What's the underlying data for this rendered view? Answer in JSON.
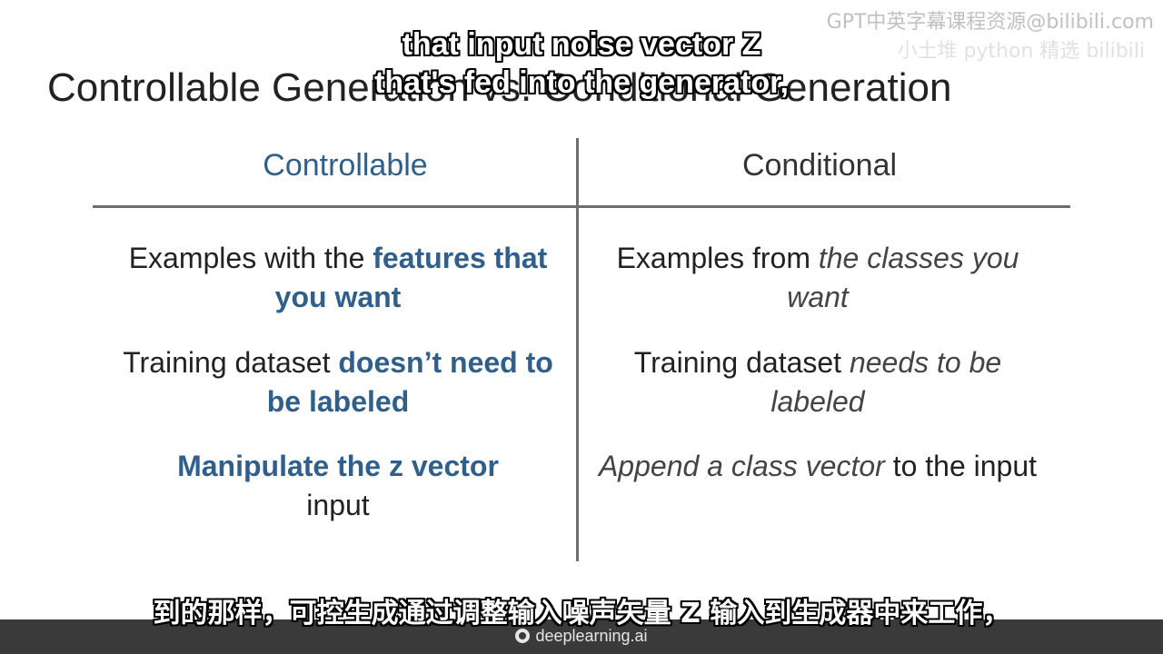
{
  "watermark": {
    "text": "GPT中英字幕课程资源@bilibili.com",
    "subtext": "小土堆 python 精选 bilibili"
  },
  "slide": {
    "title": "Controllable Generation vs. Conditional Generation",
    "columns": {
      "left": "Controllable",
      "right": "Conditional"
    },
    "rows": [
      {
        "left": {
          "pre": "Examples with the ",
          "hl": "features that you want",
          "post": ""
        },
        "right": {
          "pre": "Examples from ",
          "it": "the classes you want",
          "post": ""
        }
      },
      {
        "left": {
          "pre": "Training dataset ",
          "hl": "doesn’t need to be labeled",
          "post": ""
        },
        "right": {
          "pre": "Training dataset ",
          "it": "needs to be labeled",
          "post": ""
        }
      },
      {
        "left": {
          "pre": "",
          "hl": "Manipulate the z vector",
          "post": " input"
        },
        "right": {
          "pre": "",
          "it": "Append a class vector",
          "post": " to the input"
        }
      }
    ]
  },
  "subtitles": {
    "en_line1": "that input noise vector Z",
    "en_line2": "that's fed into the generator,",
    "zh": "到的那样，可控生成通过调整输入噪声矢量 Z 输入到生成器中来工作，"
  },
  "brand": {
    "name": "deeplearning.ai"
  }
}
